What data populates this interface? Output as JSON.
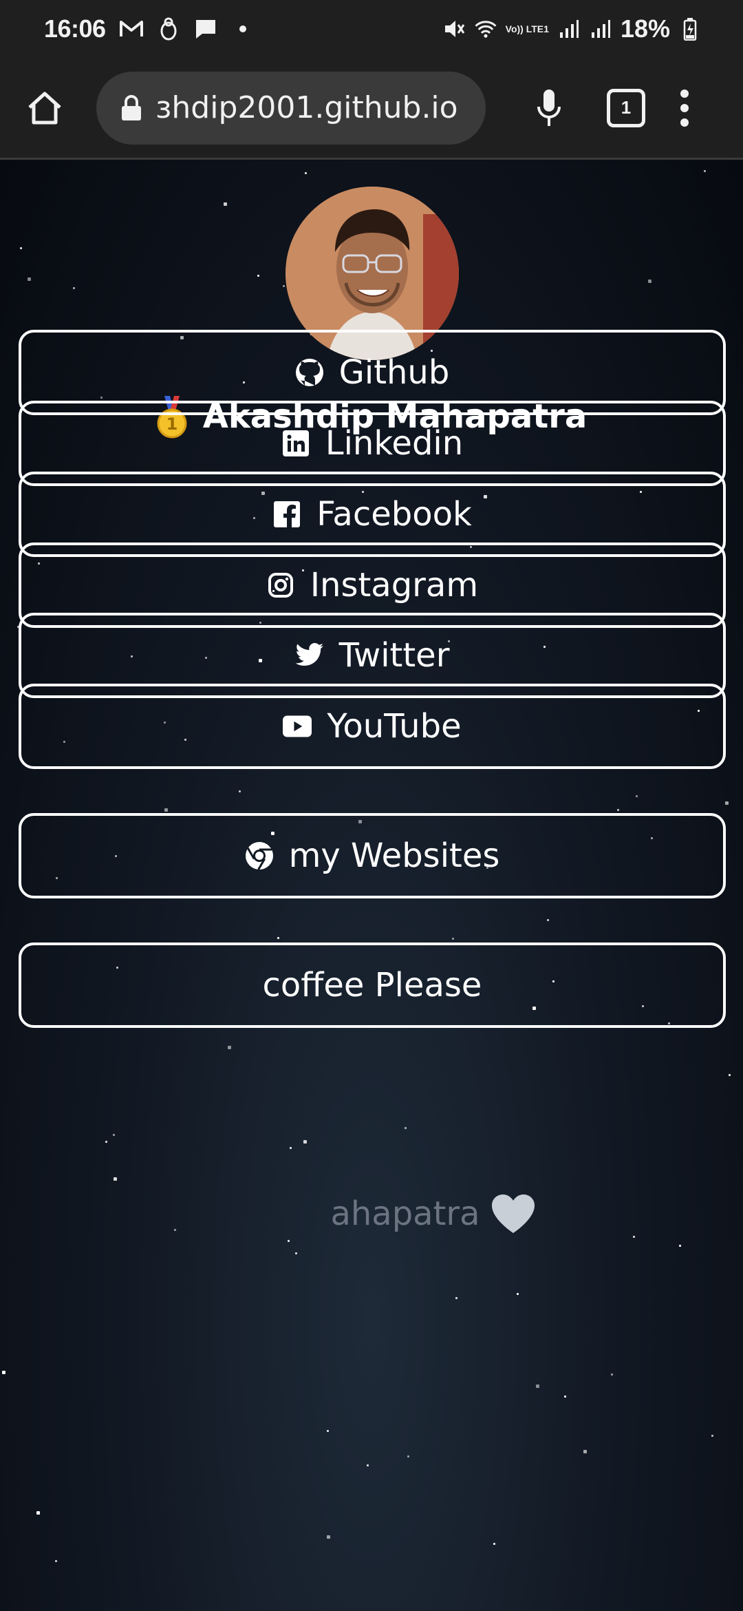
{
  "status_bar": {
    "time": "16:06",
    "battery": "18%",
    "network_label": "Vo)) LTE1"
  },
  "browser": {
    "url": "ɜhdip2001.github.io",
    "tab_count": "1"
  },
  "profile": {
    "name": "Akashdip Mahapatra"
  },
  "links": [
    {
      "label": "Github",
      "icon": "github-icon"
    },
    {
      "label": "Linkedin",
      "icon": "linkedin-icon"
    },
    {
      "label": "Facebook",
      "icon": "facebook-icon"
    },
    {
      "label": "Instagram",
      "icon": "instagram-icon"
    },
    {
      "label": "Twitter",
      "icon": "twitter-icon"
    },
    {
      "label": "YouTube",
      "icon": "youtube-icon"
    }
  ],
  "websites_button": {
    "label": "my Websites",
    "icon": "chrome-icon"
  },
  "coffee_button": {
    "label": "coffee Please"
  },
  "footer": {
    "text": "ahapatra"
  },
  "colors": {
    "background": "#0b0f16",
    "border": "#ffffff",
    "footer_text": "#6b7480"
  }
}
